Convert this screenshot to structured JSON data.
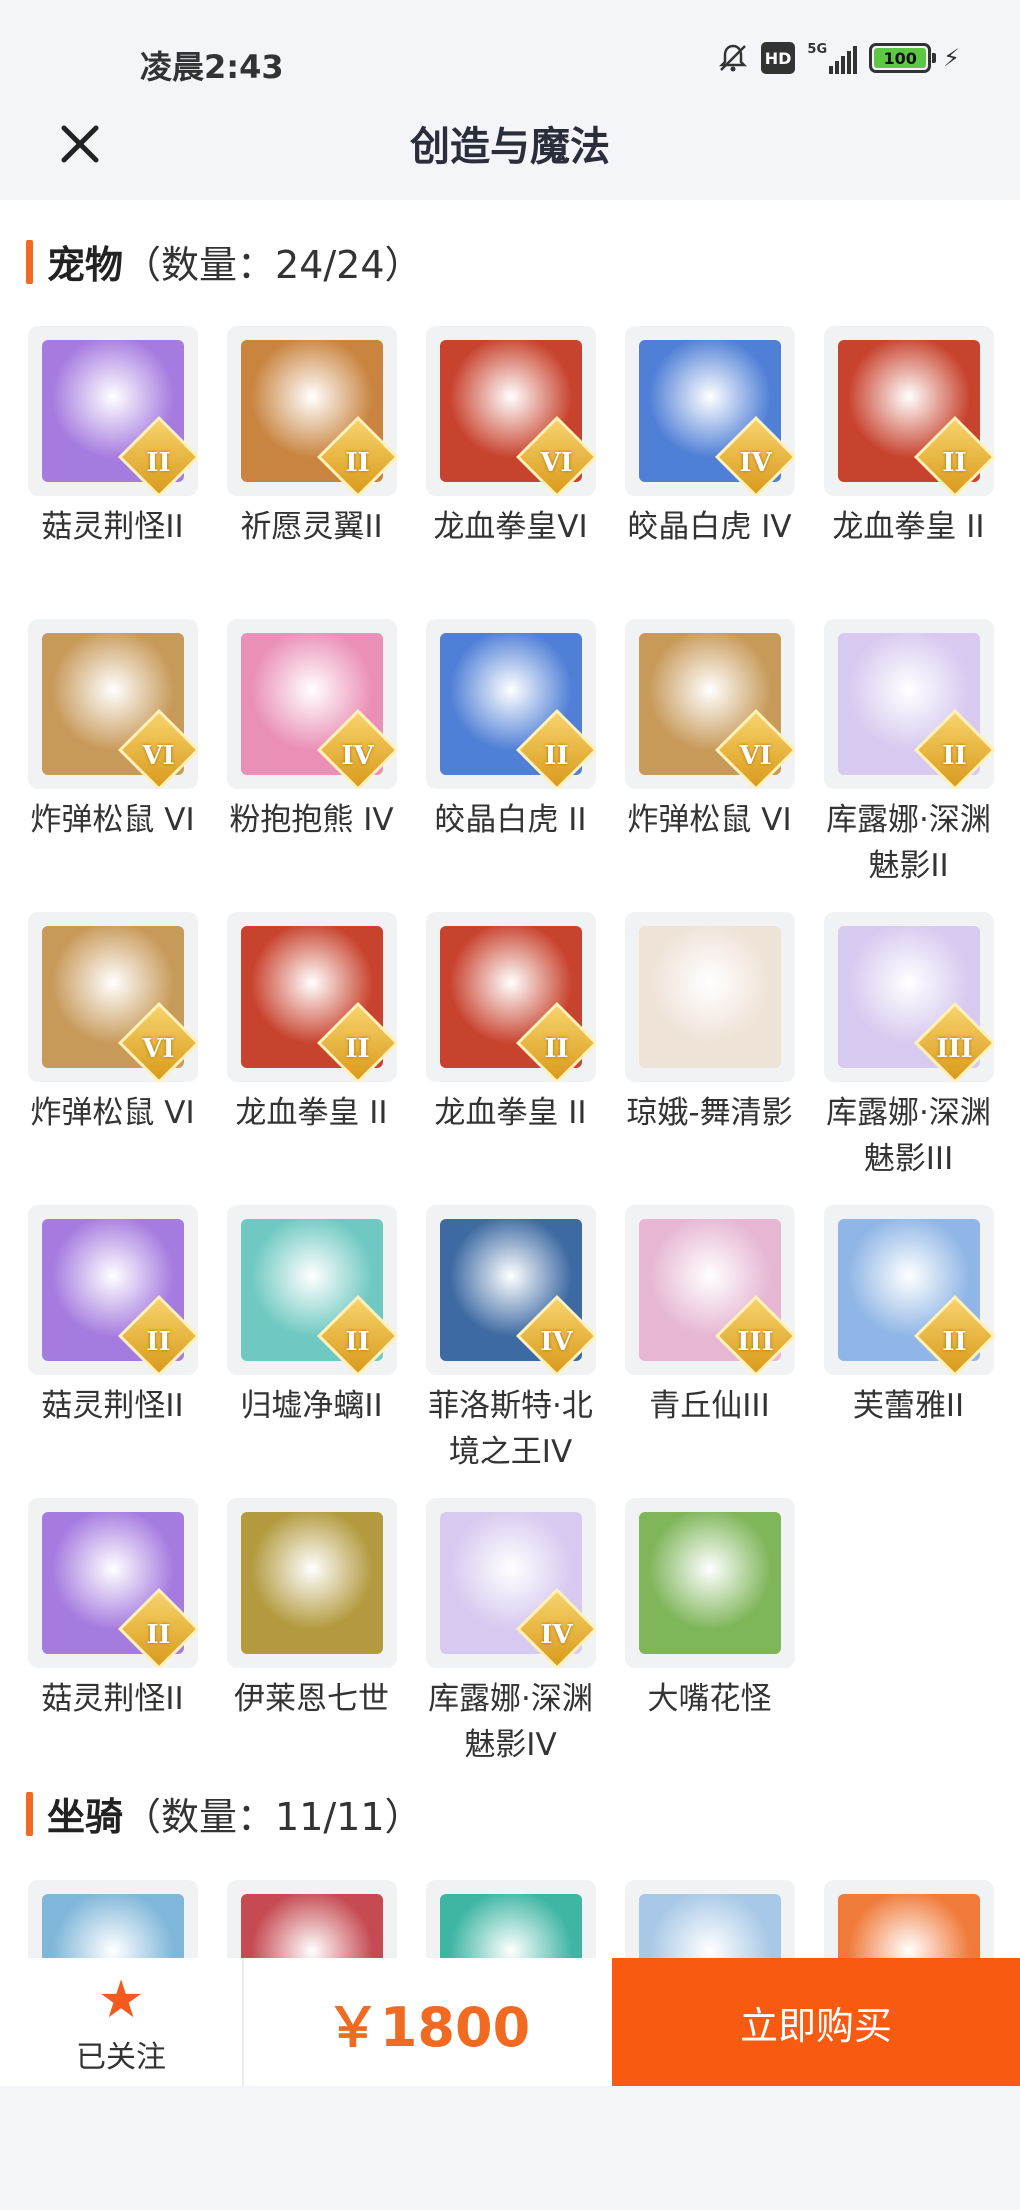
{
  "status": {
    "time": "凌晨2:43",
    "network": "5G",
    "hd": "HD",
    "battery": "100"
  },
  "nav": {
    "title": "创造与魔法"
  },
  "pets": {
    "label": "宠物",
    "count": "（数量：24/24）",
    "items": [
      {
        "name": "菇灵荆怪II",
        "rank": "II",
        "color": "#a67be0"
      },
      {
        "name": "祈愿灵翼II",
        "rank": "II",
        "color": "#c9843f"
      },
      {
        "name": "龙血拳皇VI",
        "rank": "VI",
        "color": "#c8432e"
      },
      {
        "name": "皎晶白虎 IV",
        "rank": "IV",
        "color": "#4f7fd6"
      },
      {
        "name": "龙血拳皇 II",
        "rank": "II",
        "color": "#c8432e"
      },
      {
        "name": "炸弹松鼠 VI",
        "rank": "VI",
        "color": "#c89a5a"
      },
      {
        "name": "粉抱抱熊 IV",
        "rank": "IV",
        "color": "#ea8fb6"
      },
      {
        "name": "皎晶白虎 II",
        "rank": "II",
        "color": "#4f7fd6"
      },
      {
        "name": "炸弹松鼠 VI",
        "rank": "VI",
        "color": "#c89a5a"
      },
      {
        "name": "库露娜·深渊魅影II",
        "rank": "II",
        "color": "#d7c9f0"
      },
      {
        "name": "炸弹松鼠 VI",
        "rank": "VI",
        "color": "#c89a5a"
      },
      {
        "name": "龙血拳皇 II",
        "rank": "II",
        "color": "#c8432e"
      },
      {
        "name": "龙血拳皇 II",
        "rank": "II",
        "color": "#c8432e"
      },
      {
        "name": "琼娥-舞清影",
        "rank": "",
        "color": "#efe2d6"
      },
      {
        "name": "库露娜·深渊魅影III",
        "rank": "III",
        "color": "#d7c9f0"
      },
      {
        "name": "菇灵荆怪II",
        "rank": "II",
        "color": "#a67be0"
      },
      {
        "name": "归墟净螭II",
        "rank": "II",
        "color": "#6fc9c2"
      },
      {
        "name": "菲洛斯特·北境之王IV",
        "rank": "IV",
        "color": "#3d6aa3"
      },
      {
        "name": "青丘仙III",
        "rank": "III",
        "color": "#e6b6d2"
      },
      {
        "name": "芙蕾雅II",
        "rank": "II",
        "color": "#8fb6e6"
      },
      {
        "name": "菇灵荆怪II",
        "rank": "II",
        "color": "#a67be0"
      },
      {
        "name": "伊莱恩七世",
        "rank": "",
        "color": "#b39a3e"
      },
      {
        "name": "库露娜·深渊魅影IV",
        "rank": "IV",
        "color": "#d7c9f0"
      },
      {
        "name": "大嘴花怪",
        "rank": "",
        "color": "#7fb65a"
      }
    ]
  },
  "mounts": {
    "label": "坐骑",
    "count": "（数量：11/11）",
    "items": [
      {
        "color": "#7fb6d9"
      },
      {
        "color": "#c54a52"
      },
      {
        "color": "#3fb6a4"
      },
      {
        "color": "#a7c8e6"
      },
      {
        "color": "#f07a3a"
      }
    ]
  },
  "bottom": {
    "follow_icon": "star-icon",
    "follow_label": "已关注",
    "price": "￥1800",
    "buy_label": "立即购买"
  }
}
